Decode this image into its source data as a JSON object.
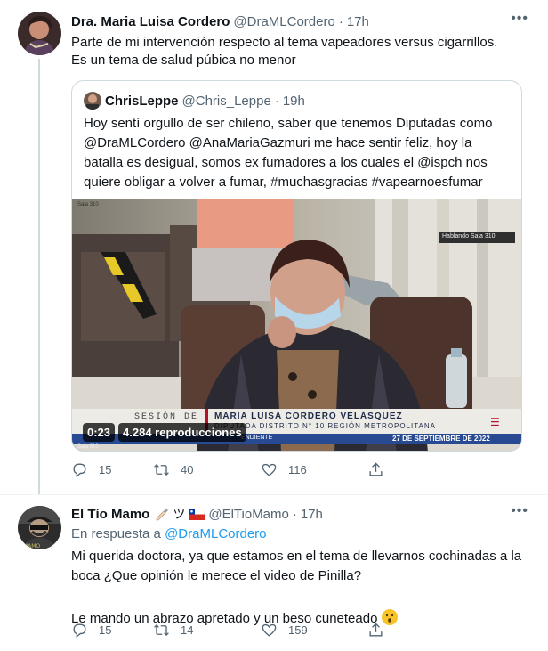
{
  "tweet1": {
    "name": "Dra. Maria Luisa Cordero",
    "handle": "@DraMLCordero",
    "time": "17h",
    "text": "Parte de mi intervención respecto al tema vapeadores versus cigarrillos. Es un tema de salud púbica no menor",
    "quote": {
      "name": "ChrisLeppe",
      "handle": "@Chris_Leppe",
      "time": "19h",
      "text": "Hoy sentí orgullo de ser chileno, saber que tenemos Diputadas como @DraMLCordero @AnaMariaGazmuri me hace sentir feliz, hoy la batalla es desigual, somos ex fumadores a los cuales el @ispch nos quiere obligar a volver a fumar, #muchasgracias #vapearnoesfumar",
      "video": {
        "duration": "0:23",
        "views": "4.284 reproducciones",
        "session_label": "SESIÓN DE",
        "lower_third_name": "MARÍA LUISA CORDERO VELÁSQUEZ",
        "lower_third_role": "DIPUTADA DISTRITO N° 10 REGIÓN METROPOLITANA",
        "lower_third_date": "27 DE SEPTIEMBRE DE 2022",
        "lower_third_left": "ENDIENTE",
        "room_sign": "Hablando Sala 310",
        "corner_label": "Sala 310"
      }
    },
    "stats": {
      "replies": "15",
      "retweets": "40",
      "likes": "116"
    }
  },
  "tweet2": {
    "name": "El Tío Mamo",
    "handle": "@ElTioMamo",
    "time": "17h",
    "reply_prefix": "En respuesta a",
    "reply_handle": "@DraMLCordero",
    "text1": "Mi querida doctora, ya que estamos en el tema de llevarnos cochinadas a la boca ¿Que opinión le merece el video de Pinilla?",
    "text2": "Le mando un abrazo apretado y un beso cuneteado",
    "name_emojis": "ツ",
    "stats": {
      "replies": "15",
      "retweets": "14",
      "likes": "159"
    }
  },
  "colors": {
    "accent": "#1d9bf0",
    "muted": "#536471",
    "border": "#cfd9de",
    "lower_third_red": "#b5122a"
  },
  "icons": [
    "more-icon",
    "reply-icon",
    "retweet-icon",
    "like-icon",
    "share-icon",
    "chile-flag-icon",
    "writing-hand-icon",
    "hushed-face-icon"
  ]
}
